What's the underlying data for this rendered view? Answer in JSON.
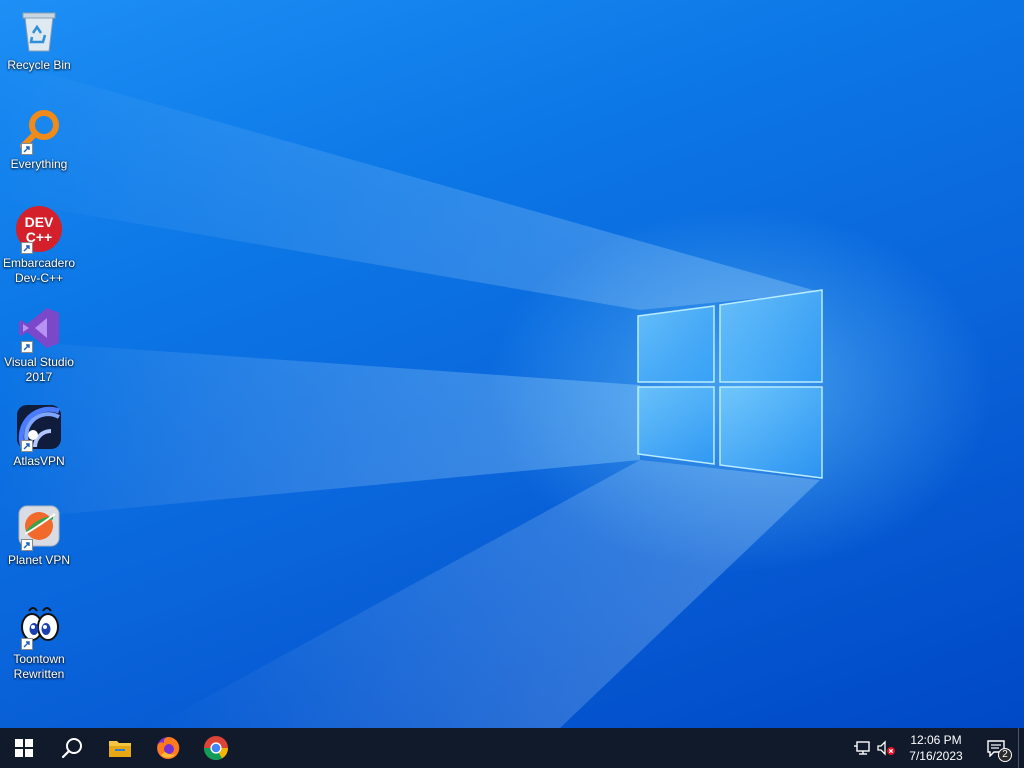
{
  "desktop": {
    "icons": [
      {
        "label": "Recycle Bin",
        "icon": "recycle-bin-icon"
      },
      {
        "label": "Everything",
        "icon": "everything-search-icon"
      },
      {
        "label": "Embarcadero\nDev-C++",
        "icon": "devcpp-icon",
        "icon_text": "DEV\nC++"
      },
      {
        "label": "Visual Studio\n2017",
        "icon": "visual-studio-icon"
      },
      {
        "label": "AtlasVPN",
        "icon": "atlasvpn-icon"
      },
      {
        "label": "Planet VPN",
        "icon": "planet-vpn-icon"
      },
      {
        "label": "Toontown\nRewritten",
        "icon": "toontown-icon"
      }
    ]
  },
  "taskbar": {
    "items": [
      {
        "name": "start-button",
        "icon": "windows-logo-icon"
      },
      {
        "name": "search-button",
        "icon": "search-icon"
      },
      {
        "name": "file-explorer-button",
        "icon": "folder-icon"
      },
      {
        "name": "firefox-button",
        "icon": "firefox-icon"
      },
      {
        "name": "chrome-button",
        "icon": "chrome-icon"
      }
    ],
    "tray": {
      "network_icon": "network-icon",
      "volume_icon": "volume-muted-icon",
      "time": "12:06 PM",
      "date": "7/16/2023",
      "notification_count": "2"
    }
  },
  "colors": {
    "taskbar_bg": "#101a2b",
    "wallpaper_primary": "#0c77e6"
  }
}
